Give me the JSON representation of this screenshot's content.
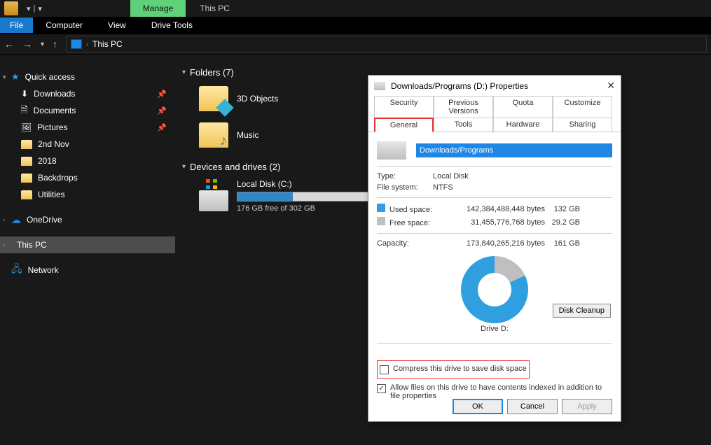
{
  "titlebar": {
    "manage": "Manage",
    "title": "This PC"
  },
  "ribbon": {
    "file": "File",
    "computer": "Computer",
    "view": "View",
    "drivetools": "Drive Tools"
  },
  "nav": {
    "path": "This PC"
  },
  "sidebar": {
    "quick": "Quick access",
    "items": [
      {
        "label": "Downloads",
        "pin": true
      },
      {
        "label": "Documents",
        "pin": true
      },
      {
        "label": "Pictures",
        "pin": true
      },
      {
        "label": "2nd Nov",
        "pin": false
      },
      {
        "label": "2018",
        "pin": false
      },
      {
        "label": "Backdrops",
        "pin": false
      },
      {
        "label": "Utilities",
        "pin": false
      }
    ],
    "onedrive": "OneDrive",
    "thispc": "This PC",
    "network": "Network"
  },
  "main": {
    "folders_head": "Folders (7)",
    "folder_a": "3D Objects",
    "folder_b": "Music",
    "devices_head": "Devices and drives (2)",
    "drive_name": "Local Disk (C:)",
    "drive_sub": "176 GB free of 302 GB"
  },
  "dialog": {
    "title": "Downloads/Programs (D:) Properties",
    "tabs": {
      "security": "Security",
      "previous": "Previous Versions",
      "quota": "Quota",
      "customize": "Customize",
      "general": "General",
      "tools": "Tools",
      "hardware": "Hardware",
      "sharing": "Sharing"
    },
    "name_value": "Downloads/Programs",
    "type_l": "Type:",
    "type_v": "Local Disk",
    "fs_l": "File system:",
    "fs_v": "NTFS",
    "used_l": "Used space:",
    "used_b": "142,384,488,448 bytes",
    "used_g": "132 GB",
    "free_l": "Free space:",
    "free_b": "31,455,776,768 bytes",
    "free_g": "29.2 GB",
    "cap_l": "Capacity:",
    "cap_b": "173,840,265,216 bytes",
    "cap_g": "161 GB",
    "drive_lbl": "Drive D:",
    "cleanup": "Disk Cleanup",
    "compress": "Compress this drive to save disk space",
    "index": "Allow files on this drive to have contents indexed in addition to file properties",
    "ok": "OK",
    "cancel": "Cancel",
    "apply": "Apply"
  }
}
